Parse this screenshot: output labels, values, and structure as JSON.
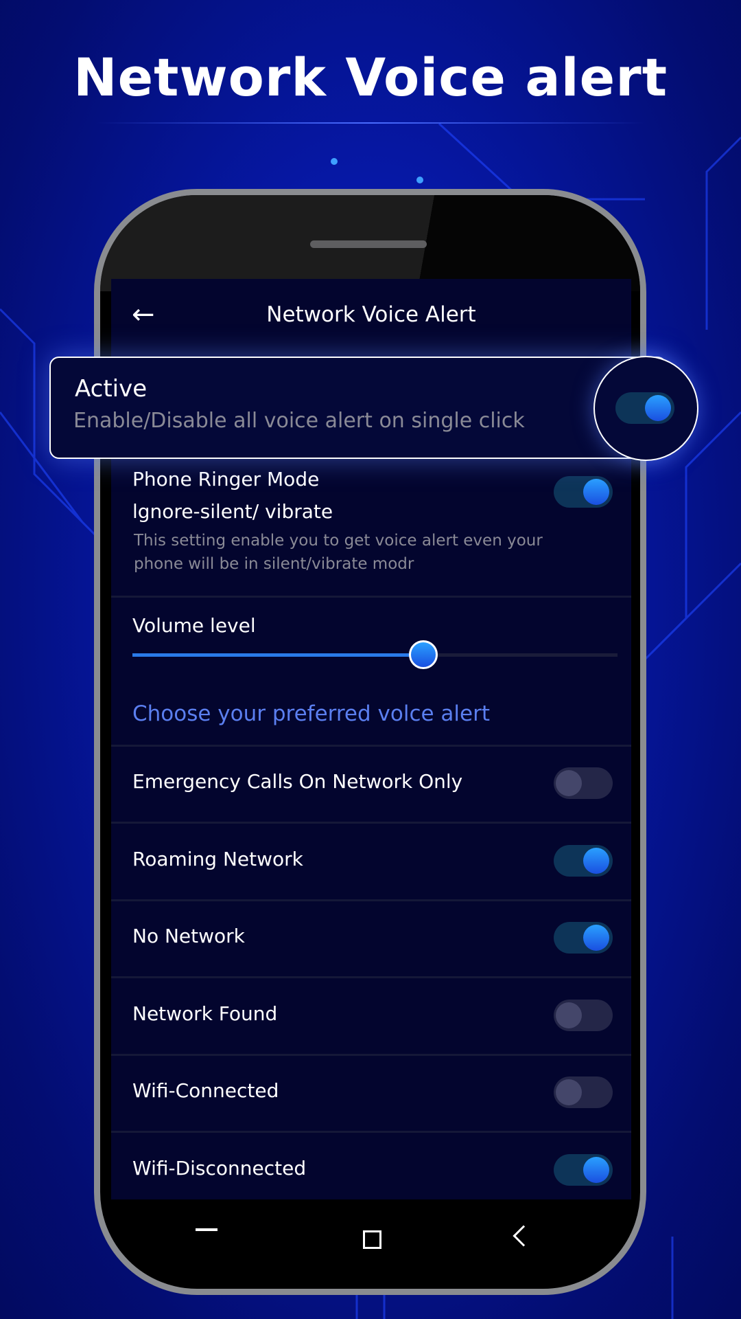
{
  "page_title": "Network Voice alert",
  "header": {
    "title": "Network Voice Alert",
    "back_icon": "arrow-left-icon"
  },
  "active_card": {
    "title": "Active",
    "subtitle": "Enable/Disable all voice alert on single click",
    "enabled": true
  },
  "ringer": {
    "title": "Phone Ringer Mode",
    "subtitle": "lgnore-silent/ vibrate",
    "desc_line1": "This setting enable you to get voice alert even your",
    "desc_line2": "phone will be in silent/vibrate modr",
    "enabled": true
  },
  "volume": {
    "label": "Volume level",
    "level_percent": 60
  },
  "section_title": "Choose your preferred volce alert",
  "alerts": [
    {
      "label": "Emergency Calls On Network Only",
      "enabled": false
    },
    {
      "label": "Roaming Network",
      "enabled": true
    },
    {
      "label": "No Network",
      "enabled": true
    },
    {
      "label": "Network Found",
      "enabled": false
    },
    {
      "label": "Wifi-Connected",
      "enabled": false
    },
    {
      "label": "Wifi-Disconnected",
      "enabled": true
    }
  ],
  "nav": {
    "icons": [
      "recent-apps-icon",
      "home-square-icon",
      "back-chevron-icon"
    ]
  },
  "colors": {
    "accent": "#5b7ff0",
    "toggle_on": "#1f7ef0",
    "screen_bg": "#03052e",
    "background": "#0618a6"
  }
}
